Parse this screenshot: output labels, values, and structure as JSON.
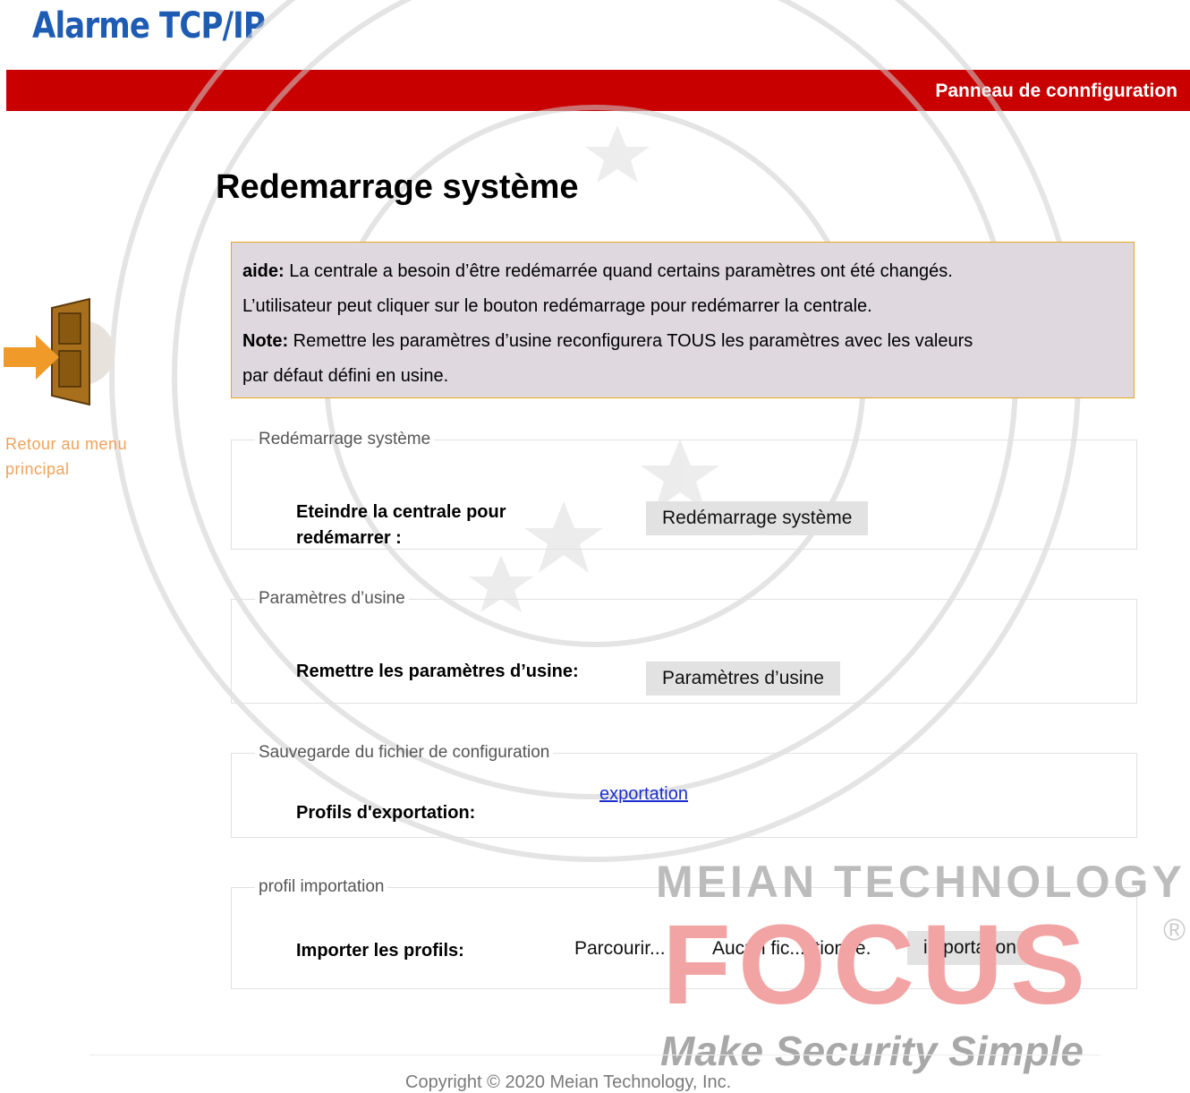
{
  "header": {
    "app_title": "Alarme TCP/IP",
    "panel_link": "Panneau de connfiguration"
  },
  "page": {
    "title": "Redemarrage système"
  },
  "help": {
    "line1_label": "aide:",
    "line1_text": " La centrale a besoin d’être redémarrée quand certains paramètres ont été changés.",
    "line2_text": "L’utilisateur peut cliquer sur le bouton redémarrage pour redémarrer la centrale.",
    "note_label": "Note:",
    "note_text": " Remettre les paramètres d’usine reconfigurera TOUS les paramètres avec les valeurs",
    "note_text2": "par défaut défini en usine."
  },
  "sidebar": {
    "back_icon": "door-exit-icon",
    "back_link_line1": "Retour au menu",
    "back_link_line2": "principal"
  },
  "sections": {
    "reboot": {
      "legend": "Redémarrage système",
      "label_line1": "Eteindre la centrale pour",
      "label_line2": "redémarrer :",
      "button": "Redémarrage système"
    },
    "factory": {
      "legend": "Paramètres d’usine",
      "label": "Remettre les paramètres d’usine:",
      "button": "Paramètres d’usine"
    },
    "backup": {
      "legend": "Sauvegarde du fichier de configuration",
      "label": "Profils d'exportation:",
      "link": "exportation"
    },
    "import": {
      "legend": "profil importation",
      "label": "Importer les profils:",
      "browse_button": "Parcourir...",
      "file_status": "Aucun fic...ctionné.",
      "import_button": "importation"
    }
  },
  "branding": {
    "line1": "MEIAN TECHNOLOGY",
    "line2": "FOCUS",
    "reg_mark": "®",
    "tagline": "Make Security Simple"
  },
  "footer": {
    "copyright": "Copyright © 2020 Meian Technology, Inc."
  },
  "colors": {
    "header_bar": "#c80000",
    "title_blue": "#1e5cb4",
    "help_bg": "#dfd8df",
    "help_border": "#e5a823",
    "link_blue": "#1a2dcc"
  }
}
